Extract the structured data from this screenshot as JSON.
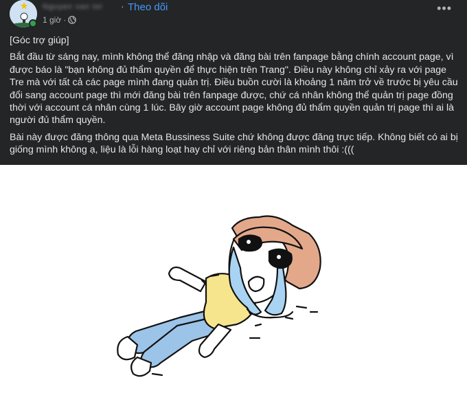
{
  "post": {
    "author_name": "Nguyen van toi",
    "follow_label": "Theo dõi",
    "separator": "·",
    "time_ago": "1 giờ",
    "audience_icon": "globe-icon",
    "more_icon": "more-options-icon",
    "more_label": "•••",
    "paragraphs": [
      "[Góc trợ giúp]",
      "Bắt đầu từ sáng nay, mình không thể đăng nhập và đăng bài trên fanpage bằng chính account page, vì được báo là \"bạn không đủ thẩm quyền để thực hiện trên Trang\". Điều này không chỉ xảy ra với page Tre mà với tất cả các page mình đang quản trị. Điều buồn cười là khoảng 1 năm trở về trước bị yêu cầu đổi sang account page thì mới đăng bài trên fanpage được, chứ cá nhân không thể quản trị page đồng thời với account cá nhân cùng 1 lúc. Bây giờ account page không đủ thẩm quyền quản trị page thì ai là người đủ thẩm quyền.",
      "Bài này được đăng thông qua Meta Bussiness Suite chứ không được đăng trực tiếp. Không biết có ai bị giống mình không ạ, liệu là lỗi hàng loạt hay chỉ với riêng bản thân mình thôi :((("
    ]
  },
  "colors": {
    "post_background": "#242526",
    "text_primary": "#e4e6eb",
    "text_secondary": "#b0b3b8",
    "link_blue": "#4599ff",
    "online_green": "#31a24c",
    "illustration_hair": "#e3a88a",
    "illustration_shirt": "#f6e58d",
    "illustration_pants": "#9cc3e8",
    "illustration_tears": "#a9d3f2"
  }
}
